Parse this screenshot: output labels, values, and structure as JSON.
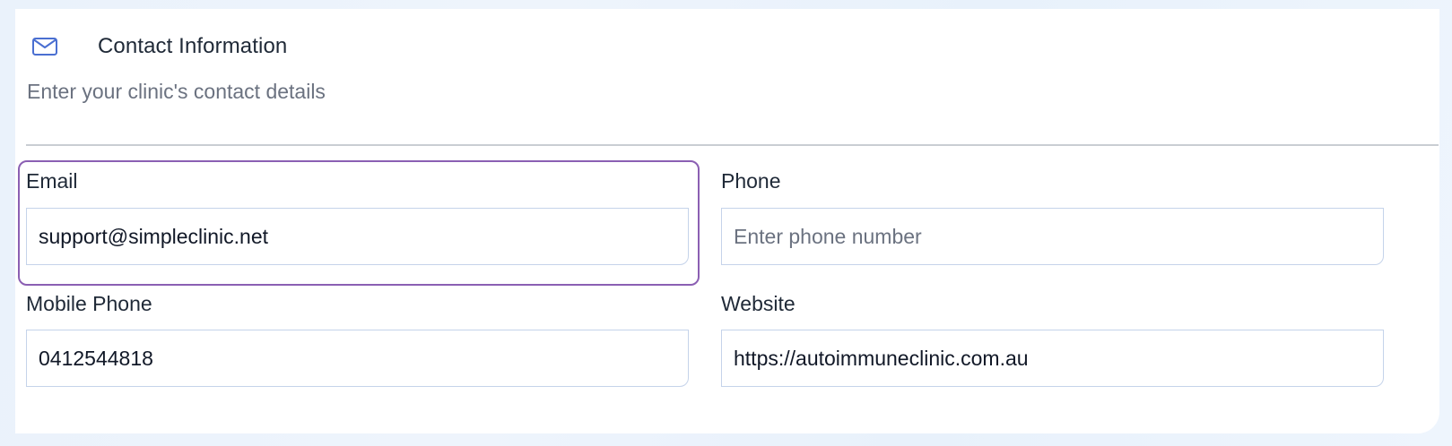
{
  "section": {
    "icon": "mail-icon",
    "title": "Contact Information",
    "subtitle": "Enter your clinic's contact details"
  },
  "fields": {
    "email": {
      "label": "Email",
      "value": "support@simpleclinic.net",
      "placeholder": ""
    },
    "phone": {
      "label": "Phone",
      "value": "",
      "placeholder": "Enter phone number"
    },
    "mobile_phone": {
      "label": "Mobile Phone",
      "value": "0412544818",
      "placeholder": ""
    },
    "website": {
      "label": "Website",
      "value": "https://autoimmuneclinic.com.au",
      "placeholder": ""
    }
  },
  "colors": {
    "focus_outline": "#8b5fb3",
    "icon_accent": "#4a6fd1",
    "input_border": "#c5d3ea"
  }
}
